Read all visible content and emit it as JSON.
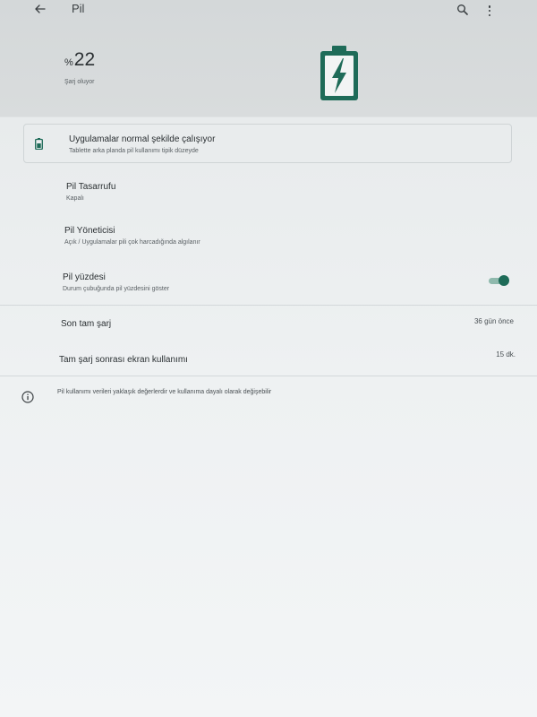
{
  "appbar": {
    "title": "Pil"
  },
  "header": {
    "percent_sign": "%",
    "level": "22",
    "status": "Şarj oluyor"
  },
  "card": {
    "title": "Uygulamalar normal şekilde çalışıyor",
    "subtitle": "Tablette arka planda pil kullanımı tipik düzeyde"
  },
  "settings": {
    "battery_saver": {
      "title": "Pil Tasarrufu",
      "subtitle": "Kapalı"
    },
    "battery_manager": {
      "title": "Pil Yöneticisi",
      "subtitle": "Açık / Uygulamalar pili çok harcadığında algılanır"
    },
    "battery_percentage": {
      "title": "Pil yüzdesi",
      "subtitle": "Durum çubuğunda pil yüzdesini göster",
      "enabled": true
    }
  },
  "usage": {
    "last_full_charge": {
      "title": "Son tam şarj",
      "value": "36 gün önce"
    },
    "screen_usage": {
      "title": "Tam şarj sonrası ekran kullanımı",
      "value": "15 dk."
    }
  },
  "footer": {
    "note": "Pil kullanımı verileri yaklaşık değerlerdir ve kullanıma dayalı olarak değişebilir"
  },
  "colors": {
    "accent": "#1e6b58",
    "battery_icon": "#1e6b58"
  }
}
